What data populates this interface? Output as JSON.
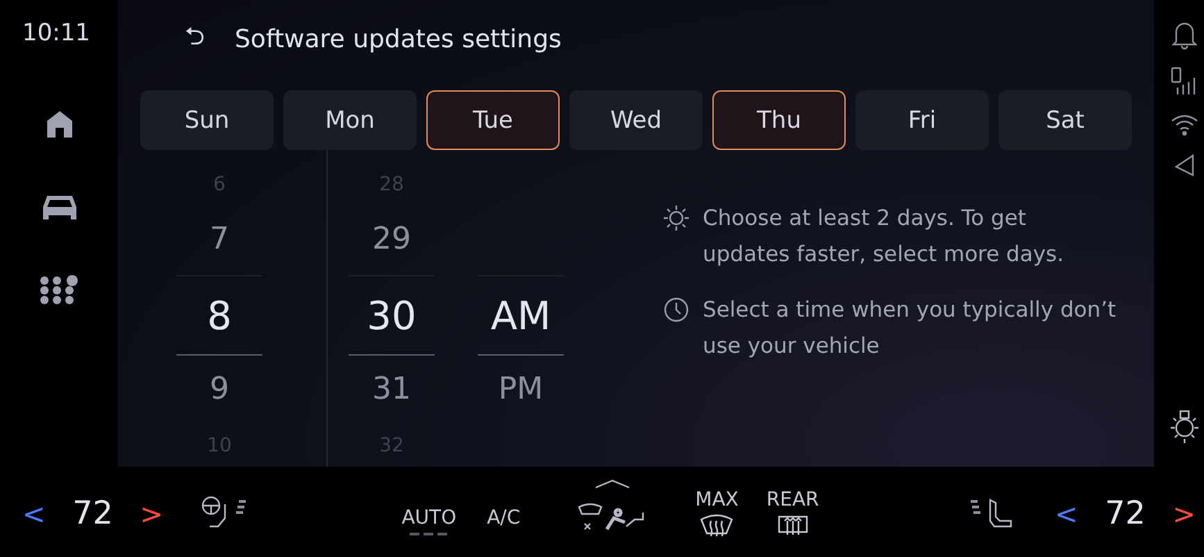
{
  "status_bar": {
    "time": "10:11"
  },
  "header": {
    "back": "⮌",
    "title": "Software updates settings"
  },
  "days": [
    {
      "label": "Sun",
      "selected": false
    },
    {
      "label": "Mon",
      "selected": false
    },
    {
      "label": "Tue",
      "selected": true
    },
    {
      "label": "Wed",
      "selected": false
    },
    {
      "label": "Thu",
      "selected": true
    },
    {
      "label": "Fri",
      "selected": false
    },
    {
      "label": "Sat",
      "selected": false
    }
  ],
  "time_picker": [
    {
      "items": [
        {
          "label": "6",
          "selected": false
        },
        {
          "label": "7",
          "selected": false
        },
        {
          "label": "8",
          "selected": true
        },
        {
          "label": "9",
          "selected": false
        },
        {
          "label": "10",
          "selected": false
        }
      ]
    },
    {
      "items": [
        {
          "label": "28",
          "selected": false
        },
        {
          "label": "29",
          "selected": false
        },
        {
          "label": "30",
          "selected": true
        },
        {
          "label": "31",
          "selected": false
        },
        {
          "label": "32",
          "selected": false
        }
      ]
    },
    {
      "items": [
        {
          "label": "AM",
          "selected": true
        },
        {
          "label": "PM",
          "selected": false
        }
      ]
    }
  ],
  "tips": [
    {
      "kind": "sun",
      "text": "Choose at least 2 days. To get updates faster, select more days."
    },
    {
      "kind": "clock",
      "text": "Select a time when you typically don’t use your vehicle"
    }
  ],
  "climate": {
    "left_temp": "72",
    "right_temp": "72",
    "decrease": "<",
    "increase": ">",
    "buttons": [
      {
        "label": "AUTO",
        "kind": "mode"
      },
      {
        "label": "A/C",
        "kind": "mode"
      },
      {
        "label": "MAX",
        "kind": "front-defrost"
      },
      {
        "label": "REAR",
        "kind": "rear-defrost"
      }
    ]
  }
}
